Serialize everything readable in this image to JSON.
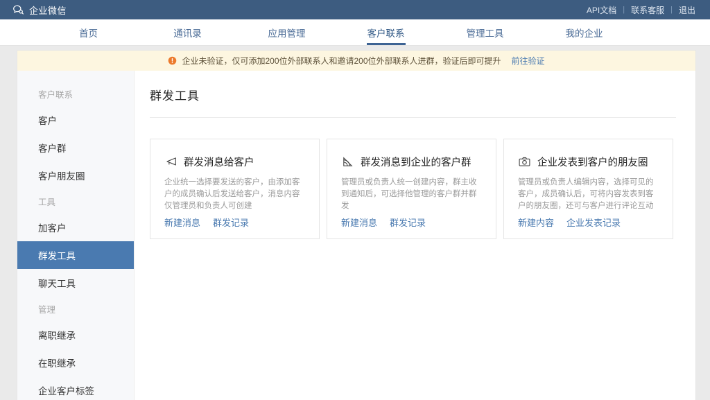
{
  "topbar": {
    "brand": "企业微信",
    "logo_icon": "speech-bubble-icon",
    "links": [
      {
        "label": "API文档"
      },
      {
        "label": "联系客服"
      },
      {
        "label": "退出"
      }
    ],
    "separator": "|",
    "bg_color": "#3d5c80"
  },
  "nav": {
    "items": [
      {
        "label": "首页",
        "active": false
      },
      {
        "label": "通讯录",
        "active": false
      },
      {
        "label": "应用管理",
        "active": false
      },
      {
        "label": "客户联系",
        "active": true
      },
      {
        "label": "管理工具",
        "active": false
      },
      {
        "label": "我的企业",
        "active": false
      }
    ],
    "active_color": "#3d6394"
  },
  "banner": {
    "icon": "warning-exclamation-icon",
    "text": "企业未验证，仅可添加200位外部联系人和邀请200位外部联系人进群，验证后即可提升",
    "link_label": "前往验证",
    "bg_color": "#fdf6e0",
    "icon_color": "#ec7a2c"
  },
  "sidebar": {
    "groups": [
      {
        "title": "客户联系",
        "items": [
          {
            "label": "客户",
            "active": false
          },
          {
            "label": "客户群",
            "active": false
          },
          {
            "label": "客户朋友圈",
            "active": false
          }
        ]
      },
      {
        "title": "工具",
        "items": [
          {
            "label": "加客户",
            "active": false
          },
          {
            "label": "群发工具",
            "active": true
          },
          {
            "label": "聊天工具",
            "active": false
          }
        ]
      },
      {
        "title": "管理",
        "items": [
          {
            "label": "离职继承",
            "active": false
          },
          {
            "label": "在职继承",
            "active": false
          },
          {
            "label": "企业客户标签",
            "active": false
          }
        ]
      }
    ],
    "active_bg": "#4a7ab0"
  },
  "main": {
    "page_title": "群发工具",
    "cards": [
      {
        "icon": "megaphone-icon",
        "title": "群发消息给客户",
        "description": "企业统一选择要发送的客户，由添加客户的成员确认后发送给客户，消息内容仅管理员和负责人可创建",
        "links": [
          {
            "label": "新建消息"
          },
          {
            "label": "群发记录"
          }
        ]
      },
      {
        "icon": "broadcast-signal-icon",
        "title": "群发消息到企业的客户群",
        "description": "管理员或负责人统一创建内容，群主收到通知后，可选择他管理的客户群并群发",
        "links": [
          {
            "label": "新建消息"
          },
          {
            "label": "群发记录"
          }
        ]
      },
      {
        "icon": "camera-icon",
        "title": "企业发表到客户的朋友圈",
        "description": "管理员或负责人编辑内容，选择可见的客户，成员确认后，可将内容发表到客户的朋友圈，还可与客户进行评论互动",
        "links": [
          {
            "label": "新建内容"
          },
          {
            "label": "企业发表记录"
          }
        ]
      }
    ],
    "link_color": "#4a7ab0"
  }
}
